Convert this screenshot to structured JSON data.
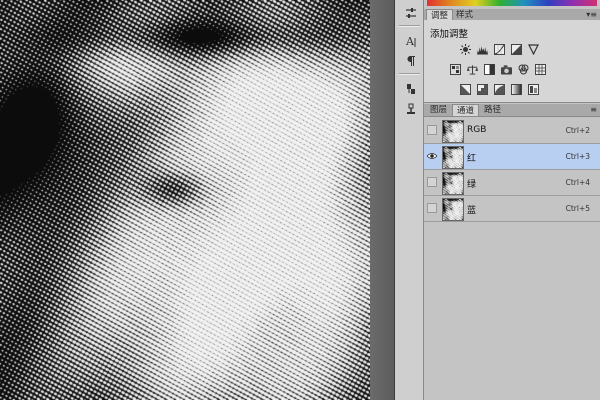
{
  "adjustments_panel": {
    "tabs": [
      {
        "label": "调整",
        "active": true
      },
      {
        "label": "样式",
        "active": false
      }
    ],
    "title": "添加调整",
    "row1_icons": [
      "brightness-contrast-icon",
      "levels-icon",
      "curves-icon",
      "exposure-icon",
      "vibrance-icon"
    ],
    "row2_icons": [
      "hue-saturation-icon",
      "color-balance-icon",
      "black-white-icon",
      "photo-filter-icon",
      "channel-mixer-icon",
      "color-lookup-icon"
    ],
    "row3_icons": [
      "invert-icon",
      "posterize-icon",
      "threshold-icon",
      "gradient-map-icon",
      "selective-color-icon"
    ]
  },
  "channels_panel": {
    "tabs": [
      {
        "label": "图层",
        "active": false
      },
      {
        "label": "通道",
        "active": true
      },
      {
        "label": "路径",
        "active": false
      }
    ],
    "channels": [
      {
        "name": "RGB",
        "shortcut": "Ctrl+2",
        "visible": false,
        "selected": false
      },
      {
        "name": "红",
        "shortcut": "Ctrl+3",
        "visible": true,
        "selected": true
      },
      {
        "name": "绿",
        "shortcut": "Ctrl+4",
        "visible": false,
        "selected": false
      },
      {
        "name": "蓝",
        "shortcut": "Ctrl+5",
        "visible": false,
        "selected": false
      }
    ]
  },
  "tools": [
    "adjust-tool-icon",
    "character-panel-icon",
    "paragraph-panel-icon",
    "clone-source-icon",
    "tool-presets-icon"
  ],
  "colors": {
    "selection": "#b9cff2",
    "panel": "#c4c4c4",
    "panel_light": "#d6d6d6"
  }
}
